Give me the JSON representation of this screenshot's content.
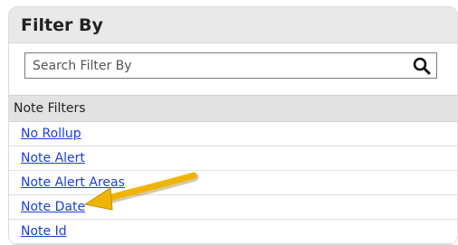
{
  "panel": {
    "title": "Filter By"
  },
  "search": {
    "placeholder": "Search Filter By",
    "icon": "search-icon"
  },
  "section": {
    "label": "Note Filters"
  },
  "filters": [
    "No Rollup",
    "Note Alert",
    "Note Alert Areas",
    "Note Date",
    "Note Id"
  ],
  "colors": {
    "link": "#1a3fd8",
    "arrow": "#f0b400"
  }
}
